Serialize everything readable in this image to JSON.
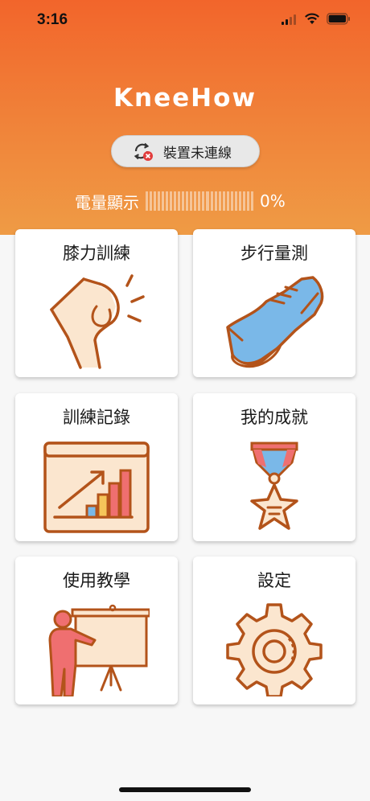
{
  "status_bar": {
    "time": "3:16"
  },
  "header": {
    "brand": "KneeHow",
    "connect_button_label": "裝置未連線",
    "battery": {
      "label": "電量顯示",
      "percent_text": "0%",
      "level": 0
    }
  },
  "menu": {
    "items": [
      {
        "label": "膝力訓練",
        "icon": "knee-icon"
      },
      {
        "label": "步行量測",
        "icon": "shoe-icon"
      },
      {
        "label": "訓練記錄",
        "icon": "chart-board-icon"
      },
      {
        "label": "我的成就",
        "icon": "medal-icon"
      },
      {
        "label": "使用教學",
        "icon": "teacher-icon"
      },
      {
        "label": "設定",
        "icon": "gear-icon"
      }
    ]
  },
  "colors": {
    "header_top": "#f2652b",
    "header_bottom": "#ef9b45",
    "icon_outline": "#b3531a",
    "icon_fill_light": "#fbe6cf",
    "icon_blue": "#7ab8e8",
    "icon_pink": "#ef6f70",
    "icon_yellow": "#f5c65a"
  }
}
